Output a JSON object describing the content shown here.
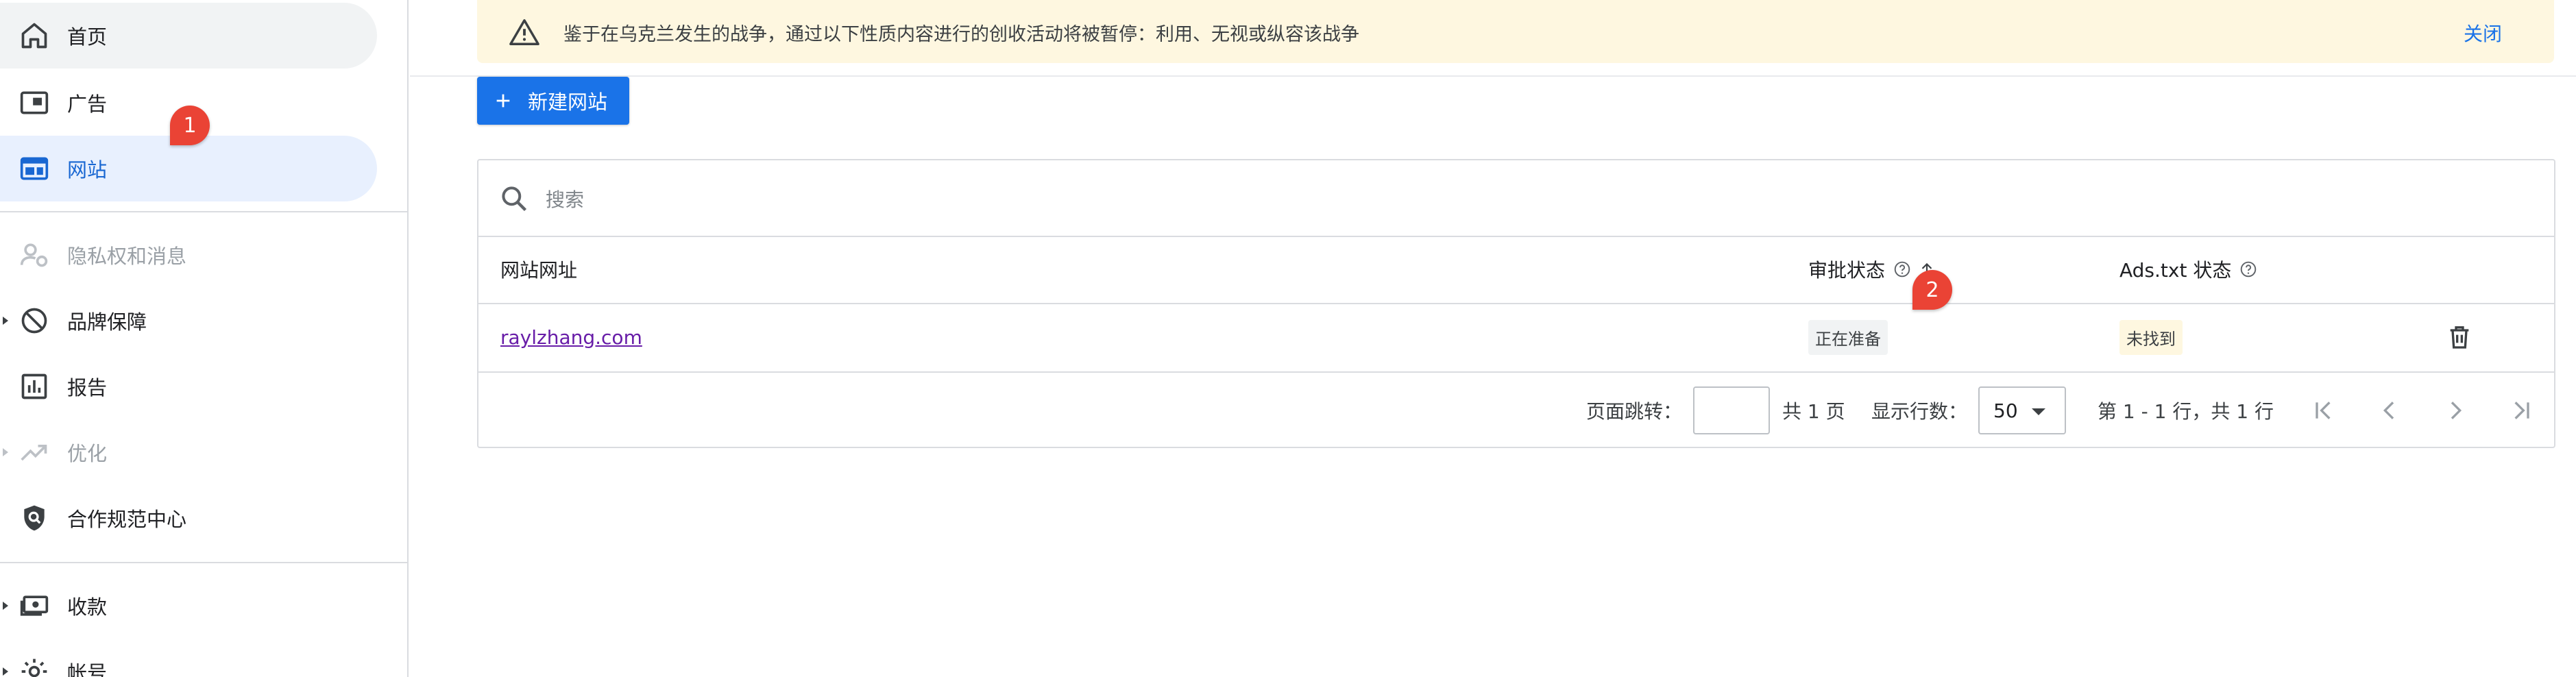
{
  "sidebar": {
    "items": [
      {
        "label": "首页",
        "icon": "home-icon"
      },
      {
        "label": "广告",
        "icon": "ad-unit-icon"
      },
      {
        "label": "网站",
        "icon": "web-icon"
      },
      {
        "label": "隐私权和消息",
        "icon": "privacy-person-icon"
      },
      {
        "label": "品牌保障",
        "icon": "block-icon"
      },
      {
        "label": "报告",
        "icon": "bar-chart-icon"
      },
      {
        "label": "优化",
        "icon": "trending-up-icon"
      },
      {
        "label": "合作规范中心",
        "icon": "policy-shield-icon"
      },
      {
        "label": "收款",
        "icon": "payments-icon"
      },
      {
        "label": "帐号",
        "icon": "settings-gear-icon"
      }
    ],
    "badge_1": "1"
  },
  "notice": {
    "icon": "warning-triangle-icon",
    "text": "鉴于在乌克兰发生的战争，通过以下性质内容进行的创收活动将被暂停：利用、无视或纵容该战争",
    "close_label": "关闭"
  },
  "toolbar": {
    "new_site_label": "新建网站"
  },
  "search": {
    "placeholder": "搜索",
    "value": ""
  },
  "table": {
    "columns": {
      "site_url": "网站网址",
      "approval_status": "审批状态",
      "ads_txt_status": "Ads.txt 状态"
    },
    "badge_2": "2",
    "rows": [
      {
        "site": "raylzhang.com",
        "approval_status": "正在准备",
        "ads_txt_status": "未找到"
      }
    ]
  },
  "pagination": {
    "jump_label": "页面跳转：",
    "page_value": "",
    "total_pages": "共 1 页",
    "rows_label": "显示行数：",
    "rows_value": "50",
    "range_text": "第 1 - 1 行，共 1 行"
  },
  "colors": {
    "primary": "#1a73e8",
    "active_nav_bg": "#e8f0fe",
    "notice_bg": "#fef7e0",
    "badge": "#ea4335",
    "link_visited": "#681da8"
  }
}
